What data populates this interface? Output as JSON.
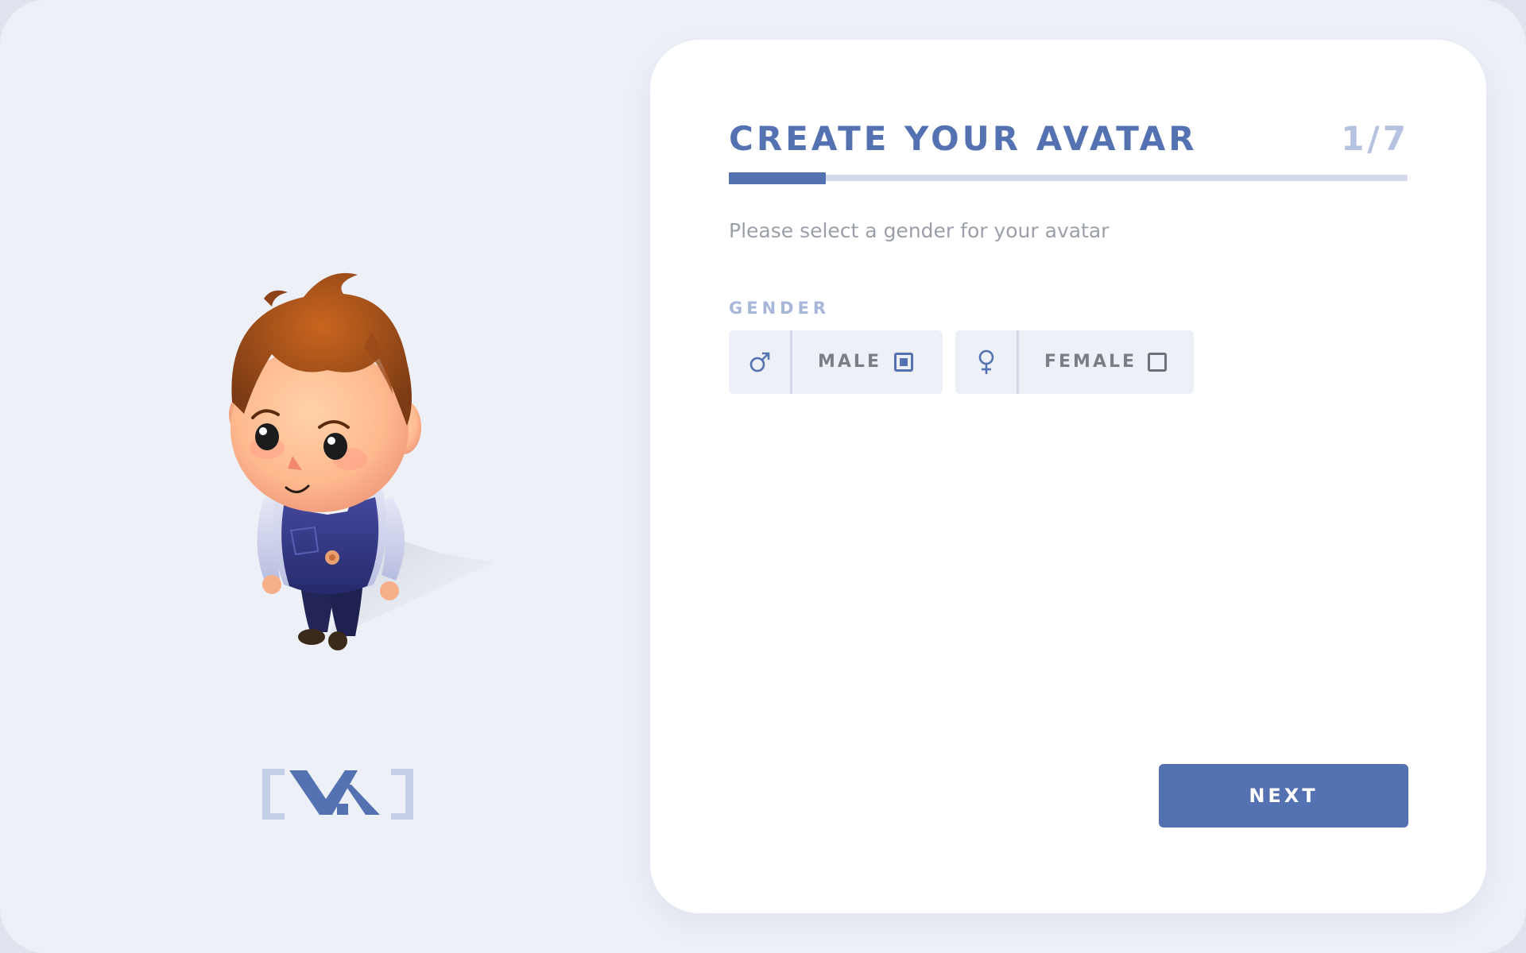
{
  "header": {
    "title": "CREATE YOUR AVATAR",
    "step": "1/7"
  },
  "progress": {
    "current_step": 1,
    "total_steps": 7,
    "fraction": 0.1429
  },
  "form": {
    "instruction": "Please select a gender for your avatar",
    "gender_label": "GENDER",
    "options": [
      {
        "label": "MALE",
        "icon": "male-symbol-icon",
        "selected": true
      },
      {
        "label": "FEMALE",
        "icon": "female-symbol-icon",
        "selected": false
      }
    ]
  },
  "actions": {
    "next_label": "NEXT"
  },
  "colors": {
    "accent": "#5472b2",
    "accent_light": "#b5c2e0",
    "background": "#edf0f7",
    "card": "#ffffff",
    "muted_text": "#9a9fa8"
  }
}
